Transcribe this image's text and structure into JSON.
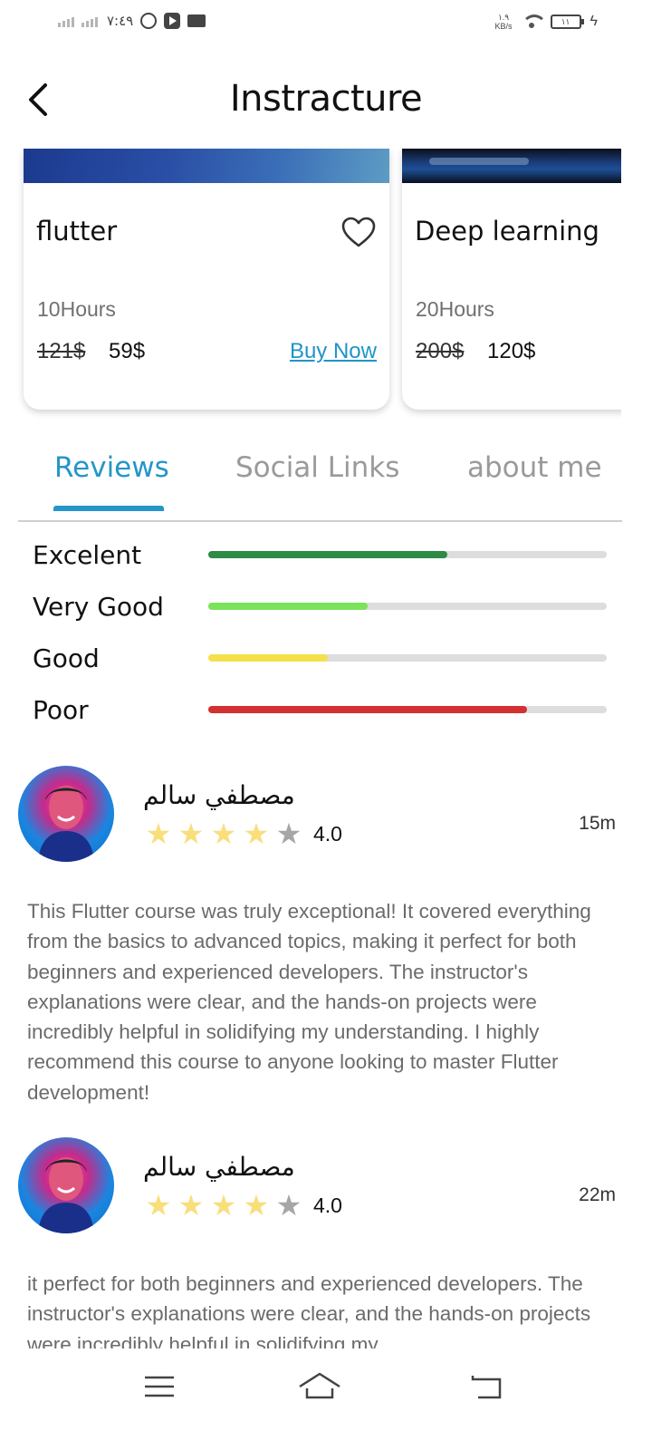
{
  "status_bar": {
    "time": "٧:٤٩",
    "net_speed_value": "١.٩",
    "net_speed_unit": "KB/s",
    "battery": "١١",
    "icons": [
      "signal-icon",
      "whatsapp-icon",
      "youtube-icon",
      "video-camera-icon",
      "wifi-icon",
      "battery-icon",
      "charging-icon"
    ]
  },
  "app_bar": {
    "title": "Instracture",
    "back_icon": "chevron-left-icon"
  },
  "courses": [
    {
      "title": "flutter",
      "hours": "10Hours",
      "old_price": "121$",
      "new_price": "59$",
      "action": "Buy Now",
      "favorite_icon": "heart-outline-icon"
    },
    {
      "title": "Deep learning",
      "hours": "20Hours",
      "old_price": "200$",
      "new_price": "120$"
    }
  ],
  "tabs": [
    {
      "label": "Reviews",
      "active": true
    },
    {
      "label": "Social Links",
      "active": false
    },
    {
      "label": "about me",
      "active": false
    }
  ],
  "accent_color": "#2496c9",
  "ratings": [
    {
      "label": "Excelent",
      "fraction": 0.6,
      "color": "#2e8b46"
    },
    {
      "label": "Very Good",
      "fraction": 0.4,
      "color": "#7ae35b"
    },
    {
      "label": "Good",
      "fraction": 0.3,
      "color": "#f5e04a"
    },
    {
      "label": "Poor",
      "fraction": 0.8,
      "color": "#d33131"
    }
  ],
  "reviews": [
    {
      "name": "مصطفي سالم",
      "stars": 4,
      "rating": "4.0",
      "time": "15m",
      "text": "This Flutter course was truly exceptional! It covered everything from the basics to advanced topics, making it perfect for both beginners and experienced developers. The instructor's explanations were clear, and the hands-on projects were incredibly helpful in solidifying my understanding. I highly recommend this course to anyone looking to master Flutter development!"
    },
    {
      "name": "مصطفي سالم",
      "stars": 4,
      "rating": "4.0",
      "time": "22m",
      "text": " it perfect for both beginners and experienced developers. The instructor's explanations were clear, and the hands-on projects were incredibly helpful in solidifying my"
    }
  ],
  "nav_bar": {
    "icons": [
      "menu-icon",
      "home-icon",
      "back-icon"
    ]
  }
}
